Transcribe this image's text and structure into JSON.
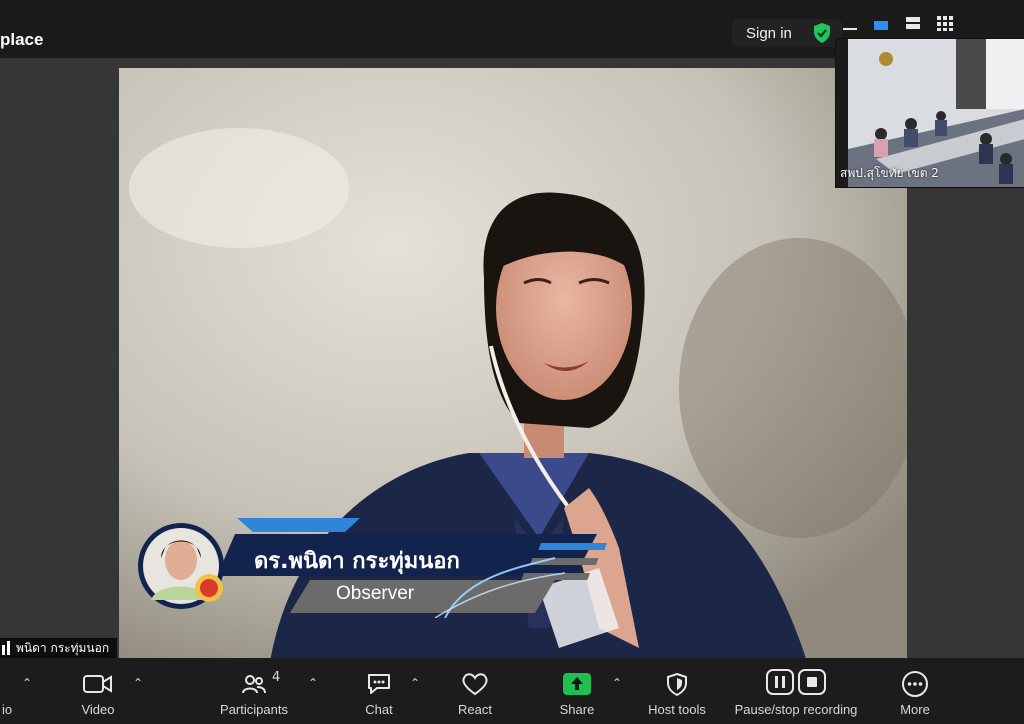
{
  "window": {
    "title_fragment": "place",
    "sign_in_label": "Sign in"
  },
  "speaker": {
    "name": "ดร.พนิดา กระทุ่มนอก",
    "role": "Observer",
    "self_view_label": "พนิดา  กระทุ่มนอก"
  },
  "thumbnail": {
    "label": "สพป.สุโขทัย เขต 2"
  },
  "toolbar": {
    "audio_label": "io",
    "video_label": "Video",
    "participants_label": "Participants",
    "participants_count": "4",
    "chat_label": "Chat",
    "react_label": "React",
    "share_label": "Share",
    "host_tools_label": "Host tools",
    "recording_label": "Pause/stop recording",
    "more_label": "More"
  },
  "colors": {
    "toolbar_bg": "#1c1c1c",
    "topbar_bg": "#1a1a1a",
    "share_green": "#1fbf53",
    "shield_green": "#22c55e",
    "banner_navy": "#12244d",
    "banner_blue": "#2f86d9",
    "role_gray": "#6b6b6b"
  },
  "icons": [
    "shield-check-icon",
    "minimize-icon",
    "speaker-view-icon",
    "gallery-view-icon",
    "chevron-up-icon",
    "video-camera-icon",
    "participants-icon",
    "chat-bubble-icon",
    "heart-icon",
    "share-arrow-icon",
    "shield-icon",
    "pause-icon",
    "stop-icon",
    "more-dots-icon"
  ]
}
